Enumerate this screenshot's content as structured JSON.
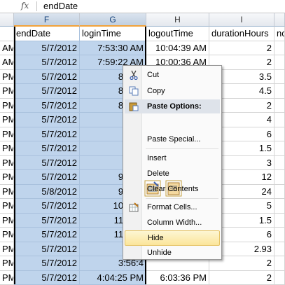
{
  "formula_bar": {
    "fx_label": "fx",
    "value": "endDate"
  },
  "columns": [
    {
      "letter": "",
      "header": "",
      "cells": [
        "AM",
        "AM",
        "PM",
        "PM",
        "PM",
        "PM",
        "PM",
        "PM",
        "PM",
        "PM",
        "PM",
        "PM",
        "PM",
        "PM",
        "PM",
        "PM",
        "PM"
      ]
    },
    {
      "letter": "F",
      "header": "endDate",
      "cells": [
        "5/7/2012",
        "5/7/2012",
        "5/7/2012",
        "5/7/2012",
        "5/7/2012",
        "5/7/2012",
        "5/7/2012",
        "5/7/2012",
        "5/7/2012",
        "5/7/2012",
        "5/8/2012",
        "5/7/2012",
        "5/7/2012",
        "5/7/2012",
        "5/7/2012",
        "5/7/2012",
        "5/7/2012"
      ]
    },
    {
      "letter": "G",
      "header": "loginTime",
      "cells": [
        "7:53:30 AM",
        "7:59:22 AM",
        "8:27:5",
        "8:22:0",
        "8:57:1",
        "",
        "",
        "",
        "",
        "9:58:3",
        "9:56:1",
        "10:26:4",
        "11:01:0",
        "11:55:3",
        "",
        "3:56:4",
        "4:04:25 PM"
      ]
    },
    {
      "letter": "H",
      "header": "logoutTime",
      "cells": [
        "10:04:39 AM",
        "10:00:36 AM",
        "",
        "",
        "",
        "",
        "",
        "",
        "",
        "",
        "",
        "",
        "",
        "",
        "",
        "",
        "6:03:36 PM"
      ]
    },
    {
      "letter": "I",
      "header": "durationHours",
      "cells": [
        "2",
        "2",
        "3.5",
        "4.5",
        "2",
        "4",
        "6",
        "1.5",
        "3",
        "12",
        "24",
        "5",
        "1.5",
        "6",
        "2.93",
        "2",
        "2"
      ]
    },
    {
      "letter": "",
      "header": "no",
      "cells": [
        "",
        "",
        "",
        "",
        "",
        "",
        "",
        "",
        "",
        "",
        "",
        "",
        "",
        "",
        "",
        "",
        ""
      ]
    }
  ],
  "context_menu": {
    "items": [
      {
        "label": "Cut",
        "icon": "scissors-icon"
      },
      {
        "label": "Copy",
        "icon": "copy-icon"
      },
      {
        "label": "Paste Options:",
        "header": true,
        "icon": "paste-icon"
      },
      {
        "label": "Paste Special...",
        "icon": ""
      },
      {
        "label": "Insert",
        "icon": ""
      },
      {
        "label": "Delete",
        "icon": ""
      },
      {
        "label": "Clear Contents",
        "icon": ""
      },
      {
        "label": "Format Cells...",
        "icon": "format-cells-icon"
      },
      {
        "label": "Column Width...",
        "icon": ""
      },
      {
        "label": "Hide",
        "icon": "",
        "highlighted": true
      },
      {
        "label": "Unhide",
        "icon": ""
      }
    ]
  },
  "colors": {
    "selection": "#bfd4ec",
    "header_selected": "#c0cfe0",
    "menu_highlight": "#fbe59a"
  }
}
